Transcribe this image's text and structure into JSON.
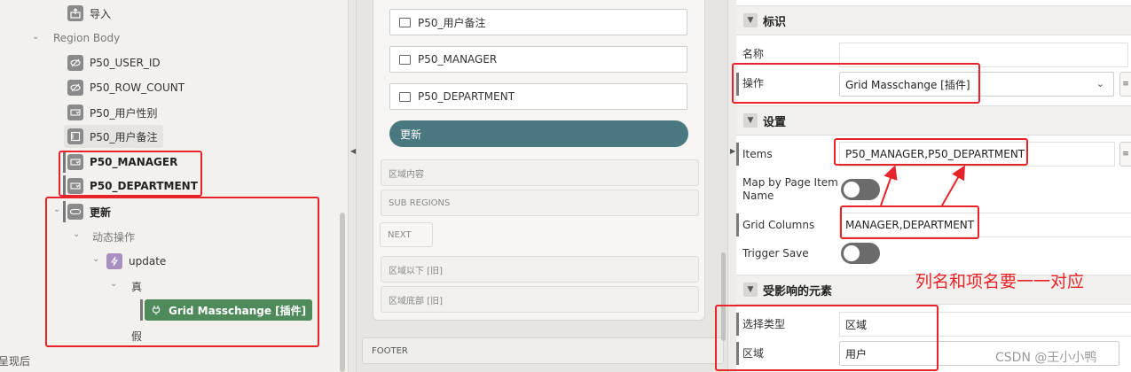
{
  "left_tree": {
    "import_item": "导入",
    "region_body": "Region Body",
    "items": [
      {
        "label": "P50_USER_ID",
        "icon": "hidden-item-icon"
      },
      {
        "label": "P50_ROW_COUNT",
        "icon": "hidden-item-icon"
      },
      {
        "label": "P50_用户性别",
        "icon": "select-list-icon"
      },
      {
        "label": "P50_用户备注",
        "icon": "textarea-icon"
      },
      {
        "label": "P50_MANAGER",
        "icon": "select-list-icon"
      },
      {
        "label": "P50_DEPARTMENT",
        "icon": "select-list-icon"
      }
    ],
    "update_button": "更新",
    "dynamic_actions": "动态操作",
    "update_da": "update",
    "true_branch": "真",
    "action_plugin": "Grid Masschange [插件]",
    "false_branch": "假",
    "cut_text": "呈现后"
  },
  "middle": {
    "items": [
      "P50_用户备注",
      "P50_MANAGER",
      "P50_DEPARTMENT"
    ],
    "update_button": "更新",
    "region_content": "区域内容",
    "sub_regions": "SUB REGIONS",
    "next": "NEXT",
    "below_region": "区域以下 [旧]",
    "region_bottom": "区域底部 [旧]",
    "footer": "FOOTER"
  },
  "right": {
    "identification": {
      "title": "标识",
      "name_label": "名称",
      "name_value": "",
      "action_label": "操作",
      "action_value": "Grid Masschange [插件]"
    },
    "settings": {
      "title": "设置",
      "items_label": "Items",
      "items_value": "P50_MANAGER,P50_DEPARTMENT",
      "map_label": "Map by Page Item Name",
      "map_on": false,
      "grid_columns_label": "Grid Columns",
      "grid_columns_value": "MANAGER,DEPARTMENT",
      "trigger_save_label": "Trigger Save",
      "trigger_save_on": false
    },
    "affected_elements": {
      "title": "受影响的元素",
      "selection_type_label": "选择类型",
      "selection_type_value": "区域",
      "region_label": "区域",
      "region_value": "用户"
    }
  },
  "annotation": {
    "text": "列名和项名要一一对应",
    "color": "#e8242a"
  },
  "watermark": "CSDN @王小小鸭",
  "colors": {
    "accent": "#4a7880",
    "plugin_green": "#4f8a5b",
    "annotation_red": "#e8242a"
  }
}
